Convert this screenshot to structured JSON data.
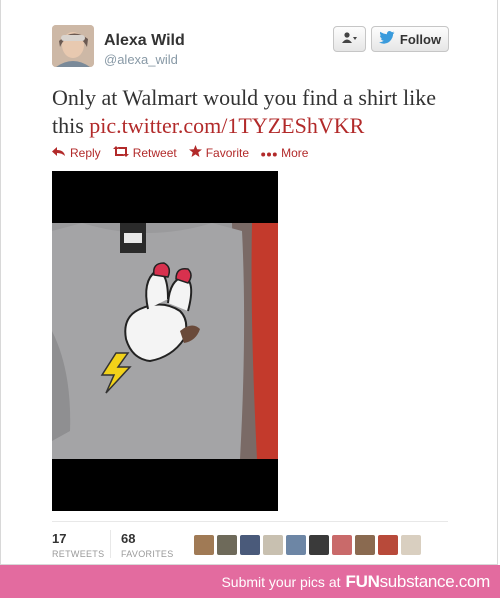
{
  "tweet": {
    "author_name": "Alexa Wild",
    "author_handle": "@alexa_wild",
    "text_before_link": "Only at Walmart would you find a shirt like this ",
    "link": "pic.twitter.com/1TYZEShVKR"
  },
  "buttons": {
    "follow_label": "Follow"
  },
  "actions": {
    "reply": "Reply",
    "retweet": "Retweet",
    "favorite": "Favorite",
    "more": "More"
  },
  "stats": {
    "retweets_count": "17",
    "retweets_label": "RETWEETS",
    "favorites_count": "68",
    "favorites_label": "FAVORITES"
  },
  "favoriters": [
    {
      "color": "#a07a55"
    },
    {
      "color": "#6e6a5a"
    },
    {
      "color": "#4a5a7a"
    },
    {
      "color": "#c8c0b0"
    },
    {
      "color": "#6d86a5"
    },
    {
      "color": "#3a3a3a"
    },
    {
      "color": "#c96a6a"
    },
    {
      "color": "#8a6a50"
    },
    {
      "color": "#b84a3a"
    },
    {
      "color": "#d9cfc0"
    }
  ],
  "banner": {
    "prompt": "Submit your pics at",
    "brand_fun": "FUN",
    "brand_substance": "substance",
    "brand_tld": ".com"
  },
  "colors": {
    "link": "#b22a2a",
    "banner": "#e36b9f"
  }
}
